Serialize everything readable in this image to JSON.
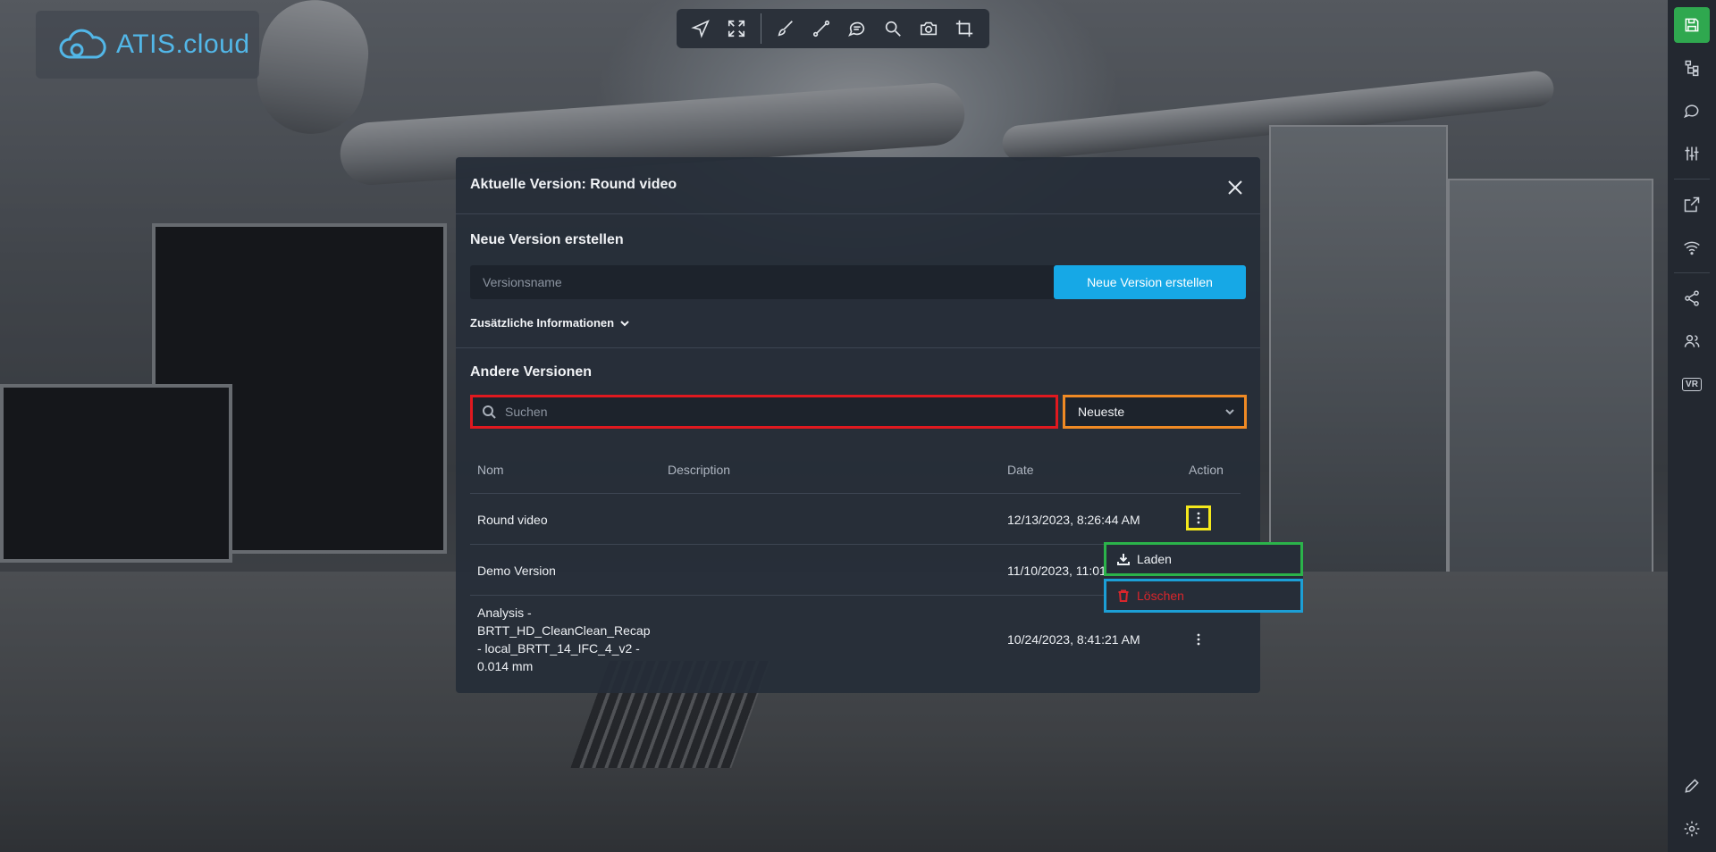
{
  "app": {
    "logo_text": "ATIS.cloud",
    "brand_color": "#52b7e8"
  },
  "toolbar": {
    "tools": [
      "navigate-icon",
      "fullscreen-icon",
      "brush-icon",
      "measure-icon",
      "comment-icon",
      "search-icon",
      "camera-icon",
      "crop-icon"
    ]
  },
  "sidebar": {
    "items": [
      "save-icon",
      "tree-icon",
      "comment-icon",
      "sliders-icon",
      "export-icon",
      "wifi-icon",
      "share-icon",
      "users-icon",
      "vr-icon",
      "pencil-icon",
      "gear-icon"
    ],
    "vr_label": "VR",
    "active_color": "#2fa84f"
  },
  "modal": {
    "title": "Aktuelle Version: Round video",
    "new_version": {
      "heading": "Neue Version erstellen",
      "input_placeholder": "Versionsname",
      "input_value": "",
      "button_label": "Neue Version erstellen",
      "additional_info_label": "Zusätzliche Informationen"
    },
    "other_versions": {
      "heading": "Andere Versionen",
      "search_placeholder": "Suchen",
      "sort_selected": "Neueste",
      "columns": [
        "Nom",
        "Description",
        "Date",
        "Action"
      ],
      "rows": [
        {
          "name": "Round video",
          "description": "",
          "date": "12/13/2023, 8:26:44 AM"
        },
        {
          "name": "Demo Version",
          "description": "",
          "date": "11/10/2023, 11:01"
        },
        {
          "name_lines": [
            "Analysis -",
            "BRTT_HD_CleanClean_Recap",
            "- local_BRTT_14_IFC_4_v2 -",
            "0.014 mm"
          ],
          "description": "",
          "date": "10/24/2023, 8:41:21 AM"
        }
      ]
    },
    "action_menu": {
      "load_label": "Laden",
      "delete_label": "Löschen",
      "delete_color": "#d9262c"
    }
  }
}
